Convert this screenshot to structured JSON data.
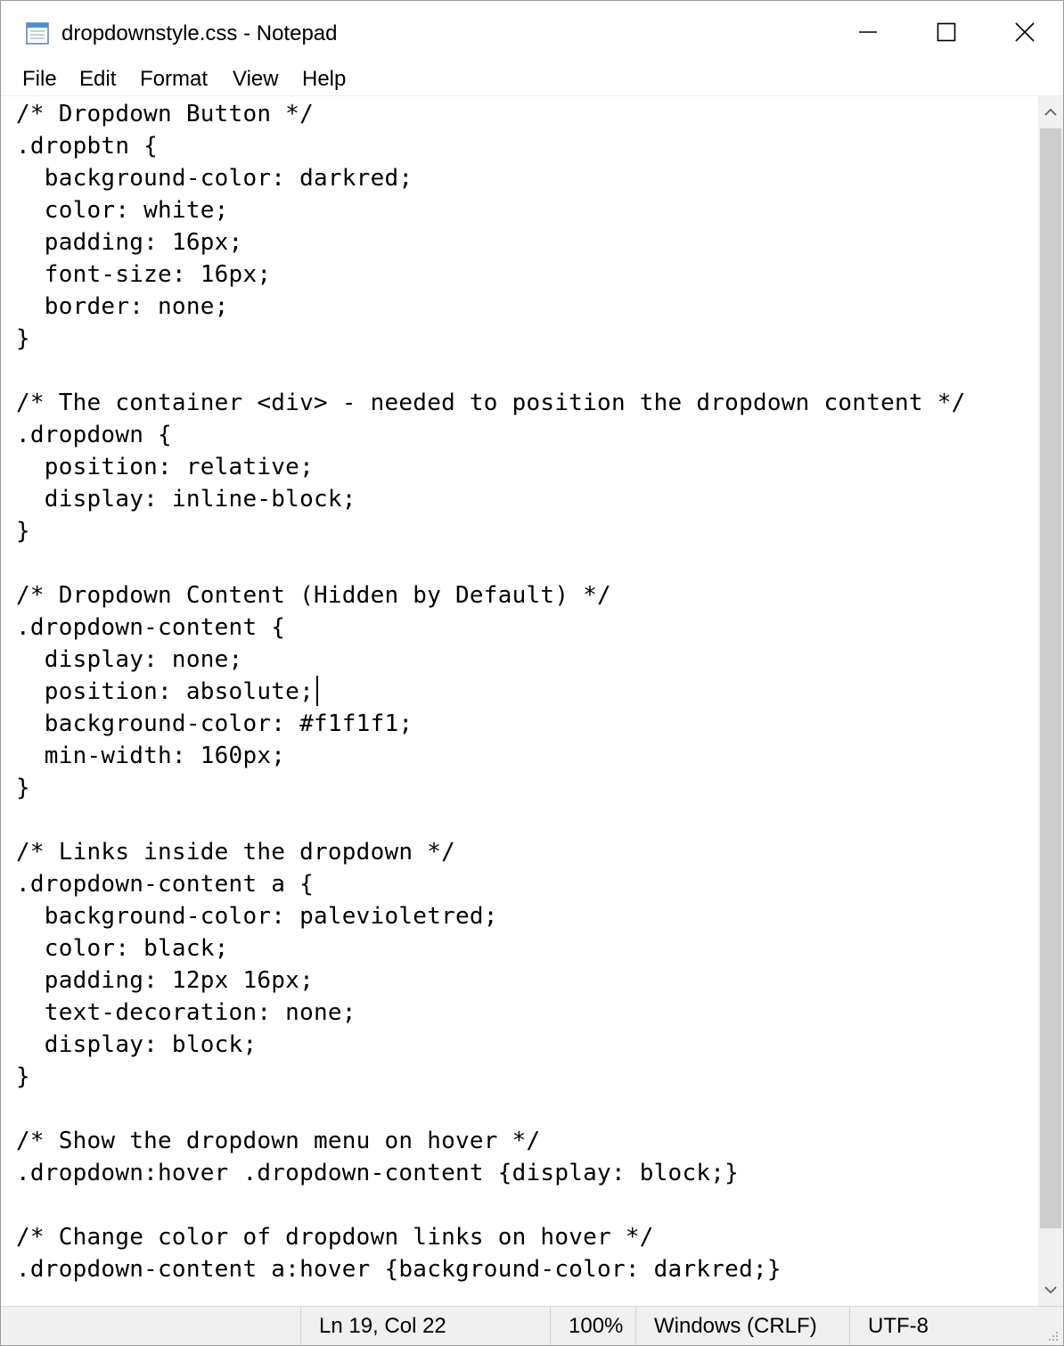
{
  "window": {
    "title": "dropdownstyle.css - Notepad",
    "icon": "notepad-icon",
    "controls": {
      "minimize": "minimize-icon",
      "maximize": "maximize-icon",
      "close": "close-icon"
    }
  },
  "menu": {
    "file": "File",
    "edit": "Edit",
    "format": "Format",
    "view": "View",
    "help": "Help"
  },
  "editor": {
    "lines": [
      "/* Dropdown Button */",
      ".dropbtn {",
      "  background-color: darkred;",
      "  color: white;",
      "  padding: 16px;",
      "  font-size: 16px;",
      "  border: none;",
      "}",
      "",
      "/* The container <div> - needed to position the dropdown content */",
      ".dropdown {",
      "  position: relative;",
      "  display: inline-block;",
      "}",
      "",
      "/* Dropdown Content (Hidden by Default) */",
      ".dropdown-content {",
      "  display: none;",
      "  position: absolute;",
      "  background-color: #f1f1f1;",
      "  min-width: 160px;",
      "}",
      "",
      "/* Links inside the dropdown */",
      ".dropdown-content a {",
      "  background-color: palevioletred;",
      "  color: black;",
      "  padding: 12px 16px;",
      "  text-decoration: none;",
      "  display: block;",
      "}",
      "",
      "/* Show the dropdown menu on hover */",
      ".dropdown:hover .dropdown-content {display: block;}",
      "",
      "/* Change color of dropdown links on hover */",
      ".dropdown-content a:hover {background-color: darkred;}"
    ]
  },
  "status": {
    "position": "Ln 19, Col 22",
    "zoom": "100%",
    "line_ending": "Windows (CRLF)",
    "encoding": "UTF-8"
  }
}
